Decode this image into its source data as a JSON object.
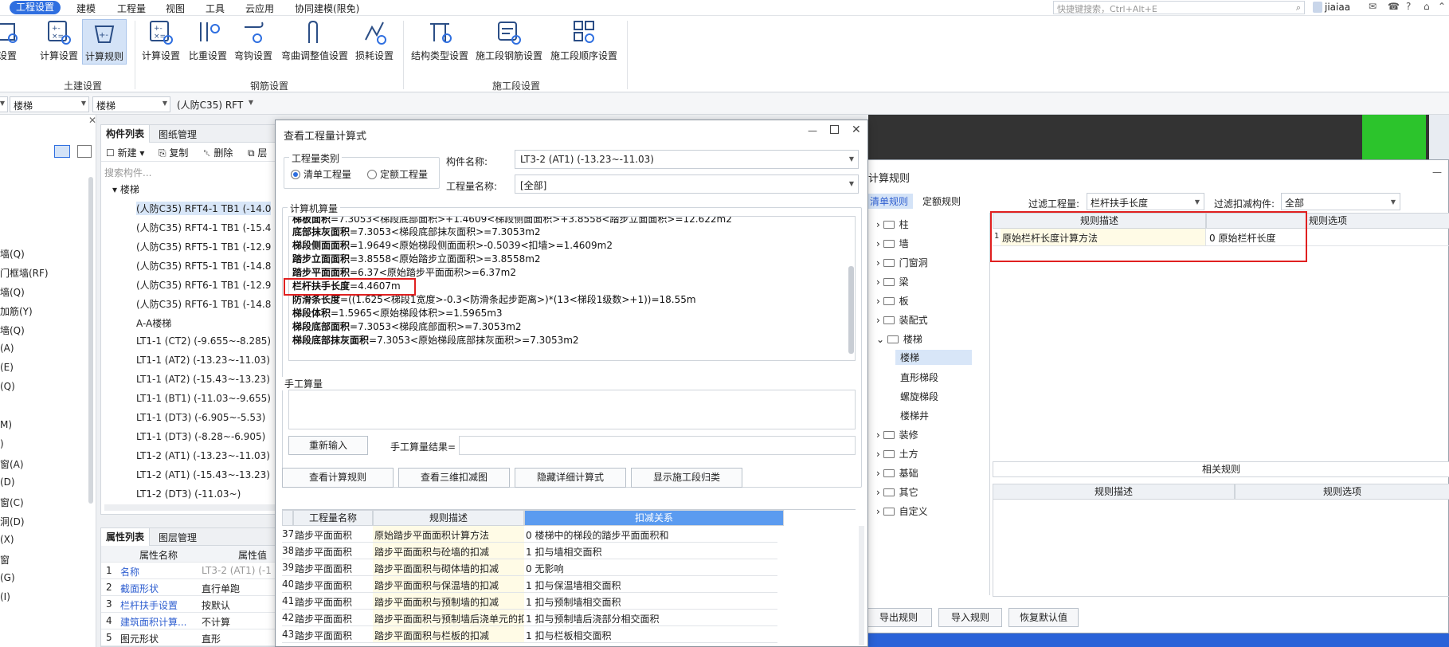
{
  "menubar": {
    "items": [
      "工程设置",
      "建模",
      "工程量",
      "视图",
      "工具",
      "云应用",
      "协同建模(限免)"
    ],
    "search_placeholder": "快捷键搜索，Ctrl+Alt+E",
    "user": "jiaiaa",
    "help": "?"
  },
  "ribbon": {
    "buttons": [
      "设置",
      "计算设置",
      "计算规则",
      "计算设置",
      "比重设置",
      "弯钩设置",
      "弯曲调整值设置",
      "损耗设置",
      "结构类型设置",
      "施工段钢筋设置",
      "施工段顺序设置"
    ],
    "groups": [
      "土建设置",
      "钢筋设置",
      "施工段设置"
    ]
  },
  "filterbar": {
    "combo1": "楼梯",
    "combo2": "楼梯",
    "combo3": "(人防C35)  RFT"
  },
  "left_strip": {
    "items": [
      "墙(Q)",
      "门框墙(RF)",
      "墙(Q)",
      "加筋(Y)",
      "墙(Q)",
      "(A)",
      "(E)",
      "(Q)",
      "M)",
      ")",
      "窗(A)",
      "(D)",
      "窗(C)",
      "洞(D)",
      "(X)",
      "窗",
      "(G)",
      "(I)"
    ]
  },
  "component_panel": {
    "tabs": [
      "构件列表",
      "图纸管理"
    ],
    "toolbar": [
      "新建",
      "复制",
      "删除",
      "层"
    ],
    "search_placeholder": "搜索构件...",
    "root": "楼梯",
    "items": [
      "(人防C35)  RFT4-1  TB1  (-14.0",
      "(人防C35)  RFT4-1  TB1  (-15.4",
      "(人防C35)  RFT5-1  TB1  (-12.9",
      "(人防C35)  RFT5-1  TB1  (-14.8",
      "(人防C35)  RFT6-1  TB1  (-12.9",
      "(人防C35)  RFT6-1  TB1  (-14.8",
      "A-A楼梯",
      "LT1-1  (CT2)  (-9.655~-8.285)",
      "LT1-1  (AT2)  (-13.23~-11.03)",
      "LT1-1  (AT2)  (-15.43~-13.23)",
      "LT1-1  (BT1)  (-11.03~-9.655)",
      "LT1-1  (DT3)  (-6.905~-5.53)",
      "LT1-1  (DT3)  (-8.28~-6.905)",
      "LT1-2  (AT1)  (-13.23~-11.03)",
      "LT1-2  (AT1)  (-15.43~-13.23)",
      "LT1-2  (DT3)  (-11.03~)"
    ]
  },
  "property_panel": {
    "tabs": [
      "属性列表",
      "图层管理"
    ],
    "headers": [
      "属性名称",
      "属性值"
    ],
    "rows": [
      {
        "no": "1",
        "name": "名称",
        "value": "LT3-2  (AT1)  (-1"
      },
      {
        "no": "2",
        "name": "截面形状",
        "value": "直行单跑"
      },
      {
        "no": "3",
        "name": "栏杆扶手设置",
        "value": "按默认"
      },
      {
        "no": "4",
        "name": "建筑面积计算...",
        "value": "不计算"
      },
      {
        "no": "5",
        "name": "图元形状",
        "value": "直形"
      }
    ]
  },
  "rules_window": {
    "title": "计算规则",
    "tabs": [
      "清单规则",
      "定额规则"
    ],
    "filter_label": "过滤工程量:",
    "filter_value": "栏杆扶手长度",
    "filter2_label": "过滤扣减构件:",
    "filter2_value": "全部",
    "tree": [
      "柱",
      "墙",
      "门窗洞",
      "梁",
      "板",
      "装配式",
      "楼梯",
      "楼梯",
      "直形梯段",
      "螺旋梯段",
      "楼梯井",
      "装修",
      "土方",
      "基础",
      "其它",
      "自定义"
    ],
    "grid_headers": [
      "规则描述",
      "规则选项"
    ],
    "grid_row": {
      "no": "1",
      "desc": "原始栏杆长度计算方法",
      "option": "0  原始栏杆长度"
    },
    "related_title": "相关规则",
    "related_headers": [
      "规则描述",
      "规则选项"
    ],
    "buttons": [
      "导出规则",
      "导入规则",
      "恢复默认值"
    ]
  },
  "dialog": {
    "title": "查看工程量计算式",
    "qty_type_legend": "工程量类别",
    "radio1": "清单工程量",
    "radio2": "定额工程量",
    "component_name_label": "构件名称:",
    "component_name_value": "LT3-2  (AT1)  (-13.23~-11.03)",
    "qty_name_label": "工程量名称:",
    "qty_name_value": "[全部]",
    "calc_legend": "计算机算量",
    "calc_lines": [
      {
        "bold": "梯板面积",
        "rest": "=7.3053<梯段底部面积>+1.4609<梯段侧面面积>+3.8558<踏步立面面积>=12.622m2"
      },
      {
        "bold": "底部抹灰面积",
        "rest": "=7.3053<梯段底部抹灰面积>=7.3053m2"
      },
      {
        "bold": "梯段侧面面积",
        "rest": "=1.9649<原始梯段侧面面积>-0.5039<扣墙>=1.4609m2"
      },
      {
        "bold": "踏步立面面积",
        "rest": "=3.8558<原始踏步立面面积>=3.8558m2"
      },
      {
        "bold": "踏步平面面积",
        "rest": "=6.37<原始踏步平面面积>=6.37m2"
      },
      {
        "bold": "栏杆扶手长度",
        "rest": "=4.4607m"
      },
      {
        "bold": "防滑条长度",
        "rest": "=((1.625<梯段1宽度>-0.3<防滑条起步距离>)*(13<梯段1级数>+1))=18.55m"
      },
      {
        "bold": "梯段体积",
        "rest": "=1.5965<原始梯段体积>=1.5965m3"
      },
      {
        "bold": "梯段底部面积",
        "rest": "=7.3053<梯段底部面积>=7.3053m2"
      },
      {
        "bold": "梯段底部抹灰面积",
        "rest": "=7.3053<原始梯段底部抹灰面积>=7.3053m2"
      }
    ],
    "manual_legend": "手工算量",
    "reenter": "重新输入",
    "manual_result_label": "手工算量结果=",
    "buttons": [
      "查看计算规则",
      "查看三维扣减图",
      "隐藏详细计算式",
      "显示施工段归类"
    ],
    "table_headers": [
      "工程量名称",
      "规则描述",
      "扣减关系"
    ],
    "table_rows": [
      {
        "no": "37",
        "name": "踏步平面面积",
        "desc": "原始踏步平面面积计算方法",
        "rel": "0  楼梯中的梯段的踏步平面面积和"
      },
      {
        "no": "38",
        "name": "踏步平面面积",
        "desc": "踏步平面面积与砼墙的扣减",
        "rel": "1  扣与墙相交面积"
      },
      {
        "no": "39",
        "name": "踏步平面面积",
        "desc": "踏步平面面积与砌体墙的扣减",
        "rel": "0   无影响"
      },
      {
        "no": "40",
        "name": "踏步平面面积",
        "desc": "踏步平面面积与保温墙的扣减",
        "rel": "1  扣与保温墙相交面积"
      },
      {
        "no": "41",
        "name": "踏步平面面积",
        "desc": "踏步平面面积与预制墙的扣减",
        "rel": "1  扣与预制墙相交面积"
      },
      {
        "no": "42",
        "name": "踏步平面面积",
        "desc": "踏步平面面积与预制墙后浇单元的扣减",
        "rel": "1  扣与预制墙后浇部分相交面积"
      },
      {
        "no": "43",
        "name": "踏步平面面积",
        "desc": "踏步平面面积与栏板的扣减",
        "rel": "1  扣与栏板相交面积"
      }
    ]
  },
  "colors": {
    "accent": "#2f6fe0",
    "highlight_box": "#e02020",
    "grid_select": "#5b9bf0",
    "row_yellow": "#fffbe6"
  }
}
